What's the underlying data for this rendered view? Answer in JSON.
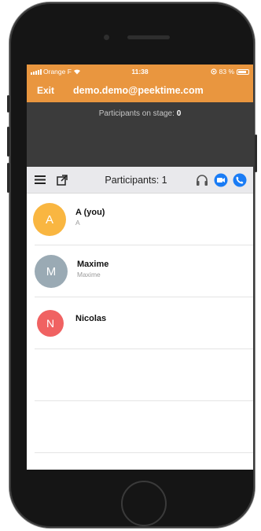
{
  "status_bar": {
    "carrier": "Orange F",
    "time": "11:38",
    "battery": "83 %",
    "battery_level": 0.83
  },
  "header": {
    "exit_label": "Exit",
    "account_email": "demo.demo@peektime.com"
  },
  "stage": {
    "label": "Participants on stage:",
    "count": "0"
  },
  "toolbar": {
    "title": "Participants: 1",
    "icons": [
      "menu-icon",
      "external-link-icon",
      "headphones-icon",
      "video-call-icon",
      "phone-call-icon"
    ]
  },
  "participants": [
    {
      "initial": "A",
      "name": "A (you)",
      "subtitle": "A",
      "color": "#f9b641"
    },
    {
      "initial": "M",
      "name": "Maxime",
      "subtitle": "Maxime",
      "color": "#9aaab4"
    },
    {
      "initial": "N",
      "name": "Nicolas",
      "subtitle": "",
      "color": "#f06262"
    }
  ],
  "colors": {
    "accent": "#e9963f",
    "stage_bg": "#3b3b3b",
    "blue": "#1a7cf5"
  }
}
